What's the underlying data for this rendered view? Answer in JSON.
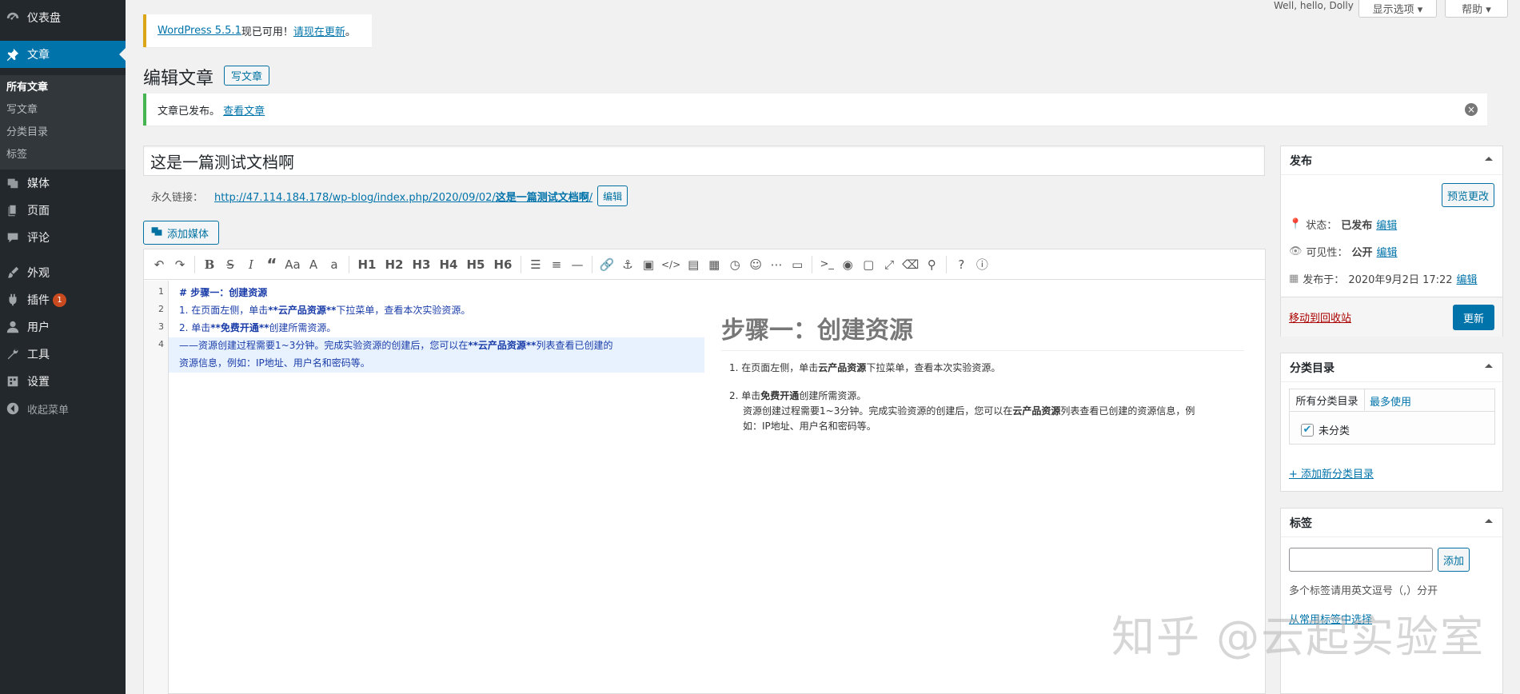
{
  "sidebar": {
    "dashboard": "仪表盘",
    "posts": "文章",
    "sub_all_posts": "所有文章",
    "sub_new_post": "写文章",
    "sub_categories": "分类目录",
    "sub_tags": "标签",
    "media": "媒体",
    "pages": "页面",
    "comments": "评论",
    "appearance": "外观",
    "plugins": "插件",
    "plugins_badge": "1",
    "users": "用户",
    "tools": "工具",
    "settings": "设置",
    "collapse": "收起菜单"
  },
  "topbar": {
    "hello": "Well, hello, Dolly",
    "screen_options": "显示选项 ▾",
    "help": "帮助 ▾"
  },
  "update_nag": {
    "version_link": "WordPress 5.5.1",
    "text": "现已可用！",
    "update_link": "请现在更新",
    "end": "。"
  },
  "page": {
    "heading": "编辑文章",
    "add_new": "写文章"
  },
  "notice": {
    "text": "文章已发布。",
    "view_link": "查看文章"
  },
  "post": {
    "title": "这是一篇测试文档啊",
    "permalink_label": "永久链接：",
    "permalink_base": "http://47.114.184.178/wp-blog/index.php/2020/09/02/",
    "permalink_slug": "这是一篇测试文档啊",
    "permalink_end": "/",
    "edit_button": "编辑"
  },
  "editor": {
    "add_media": "添加媒体",
    "toolbar_headings": [
      "H1",
      "H2",
      "H3",
      "H4",
      "H5",
      "H6"
    ],
    "line_numbers": [
      "1",
      "2",
      "3",
      "4"
    ],
    "lines": {
      "l1": "# 步骤一：创建资源",
      "l2_a": "1. 在页面左侧，单击",
      "l2_b": "**云产品资源**",
      "l2_c": "下拉菜单，查看本次实验资源。",
      "l3_a": "2. 单击",
      "l3_b": "**免费开通**",
      "l3_c": "创建所需资源。",
      "l4_a": "——资源创建过程需要1~3分钟。完成实验资源的创建后，您可以在",
      "l4_b": "**云产品资源**",
      "l4_c": "列表查看已创建的",
      "l4_d": "资源信息，例如：IP地址、用户名和密码等。"
    },
    "preview": {
      "heading": "步骤一：创建资源",
      "item1_num": "1.",
      "item1_a": "在页面左侧，单击",
      "item1_b": "云产品资源",
      "item1_c": "下拉菜单，查看本次实验资源。",
      "item2_num": "2.",
      "item2_a": "单击",
      "item2_b": "免费开通",
      "item2_c": "创建所需资源。",
      "item2_p1_a": "资源创建过程需要1~3分钟。完成实验资源的创建后，您可以在",
      "item2_p1_b": "云产品资源",
      "item2_p1_c": "列表查看已创建的资源信息，例",
      "item2_p2": "如：IP地址、用户名和密码等。"
    }
  },
  "publish_box": {
    "title": "发布",
    "preview_button": "预览更改",
    "status_label": "状态：",
    "status_value": "已发布",
    "visibility_label": "可见性：",
    "visibility_value": "公开",
    "published_label": "发布于：",
    "published_value": "2020年9月2日 17:22",
    "edit_link": "编辑",
    "trash_link": "移动到回收站",
    "update_button": "更新"
  },
  "category_box": {
    "title": "分类目录",
    "tab_all": "所有分类目录",
    "tab_most_used": "最多使用",
    "item_uncategorized": "未分类",
    "add_new_link": "+ 添加新分类目录"
  },
  "tags_box": {
    "title": "标签",
    "input_value": "",
    "add_button": "添加",
    "hint": "多个标签请用英文逗号（,）分开",
    "choose_link": "从常用标签中选择"
  },
  "watermark": "知乎 @云起实验室",
  "colors": {
    "sidebar_bg": "#23282d",
    "accent": "#0073aa",
    "success": "#46b450",
    "warning": "#dba617",
    "badge": "#ca4a1f"
  }
}
